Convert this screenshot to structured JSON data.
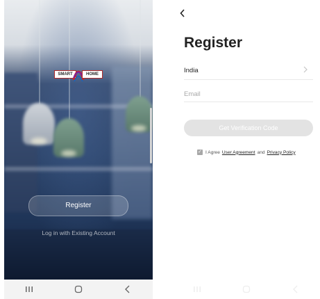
{
  "left_screen": {
    "logo": {
      "left_text": "SMART",
      "right_text": "HOME"
    },
    "register_label": "Register",
    "login_label": "Log in with Existing Account",
    "navbar": {
      "recents_icon": "recents-icon",
      "home_icon": "home-icon",
      "back_icon": "back-icon"
    }
  },
  "right_screen": {
    "back_icon": "back-arrow-icon",
    "title": "Register",
    "country": "India",
    "email_placeholder": "Email",
    "email_value": "",
    "verify_button_label": "Get Verification Code",
    "agreement": {
      "checked": true,
      "prefix": "I Agree",
      "user_agreement": "User Agreement",
      "conjunction": "and",
      "privacy_policy": "Privacy Policy"
    }
  },
  "colors": {
    "button_disabled": "#e3e3e3",
    "logo_accent": "#b02a2a",
    "title_text": "#222222"
  }
}
